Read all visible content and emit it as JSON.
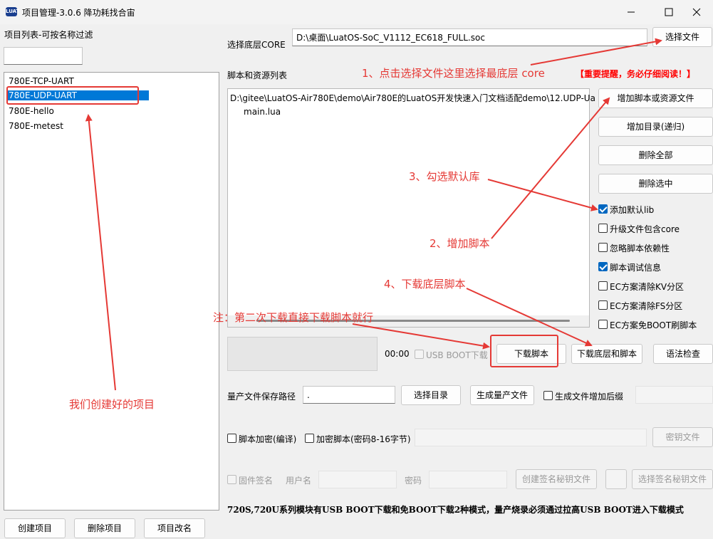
{
  "window": {
    "title": "项目管理-3.0.6 降功耗找合宙",
    "app_icon_text": "LUAT"
  },
  "sidebar": {
    "filter_label": "项目列表-可按名称过滤",
    "filter_value": "",
    "projects": [
      "780E-TCP-UART",
      "780E-UDP-UART",
      "780E-hello",
      "780E-metest"
    ],
    "selected_index": 1,
    "buttons": {
      "create": "创建项目",
      "delete": "删除项目",
      "rename": "项目改名"
    }
  },
  "core": {
    "label": "选择底层CORE",
    "path": "D:\\桌面\\LuatOS-SoC_V1112_EC618_FULL.soc",
    "select_button": "选择文件"
  },
  "scripts": {
    "label": "脚本和资源列表",
    "warning": "【重要提醒，务必仔细阅读！】",
    "items": [
      "D:\\gitee\\LuatOS-Air780E\\demo\\Air780E的LuatOS开发快速入门文档适配demo\\12.UDP-Ua",
      "main.lua"
    ],
    "buttons": {
      "add_script": "增加脚本或资源文件",
      "add_dir": "增加目录(递归)",
      "delete_all": "删除全部",
      "delete_selected": "删除选中"
    }
  },
  "options": [
    {
      "label": "添加默认lib",
      "checked": true
    },
    {
      "label": "升级文件包含core",
      "checked": false
    },
    {
      "label": "忽略脚本依赖性",
      "checked": false
    },
    {
      "label": "脚本调试信息",
      "checked": true
    },
    {
      "label": "EC方案清除KV分区",
      "checked": false
    },
    {
      "label": "EC方案清除FS分区",
      "checked": false
    },
    {
      "label": "EC方案免BOOT刷脚本",
      "checked": false
    }
  ],
  "download": {
    "time": "00:00",
    "usb_boot_label": "USB BOOT下载",
    "download_script": "下载脚本",
    "download_core_script": "下载底层和脚本",
    "syntax_check": "语法检查"
  },
  "mass_production": {
    "path_label": "量产文件保存路径",
    "path_value": ".",
    "select_dir": "选择目录",
    "generate": "生成量产文件",
    "suffix_label": "生成文件增加后缀"
  },
  "encryption": {
    "compile_label": "脚本加密(编译)",
    "encrypt_label": "加密脚本(密码8-16字节)",
    "key_file": "密钥文件"
  },
  "signing": {
    "firmware_sign": "固件签名",
    "username": "用户名",
    "password": "密码",
    "create_key": "创建签名秘钥文件",
    "select_key": "选择签名秘钥文件"
  },
  "bottom_note": "720S,720U系列模块有USB BOOT下载和免BOOT下载2种模式，量产烧录必须通过拉高USB BOOT进入下载模式",
  "annotations": {
    "step1": "1、点击选择文件这里选择最底层 core",
    "step2": "2、增加脚本",
    "step3": "3、勾选默认库",
    "step4": "4、下载底层脚本",
    "note": "注：第二次下载直接下载脚本就行",
    "projects": "我们创建好的项目"
  },
  "colors": {
    "accent": "#0078d7",
    "annotation": "#e53935",
    "warning": "#ff0000",
    "checkbox": "#0067c0"
  }
}
